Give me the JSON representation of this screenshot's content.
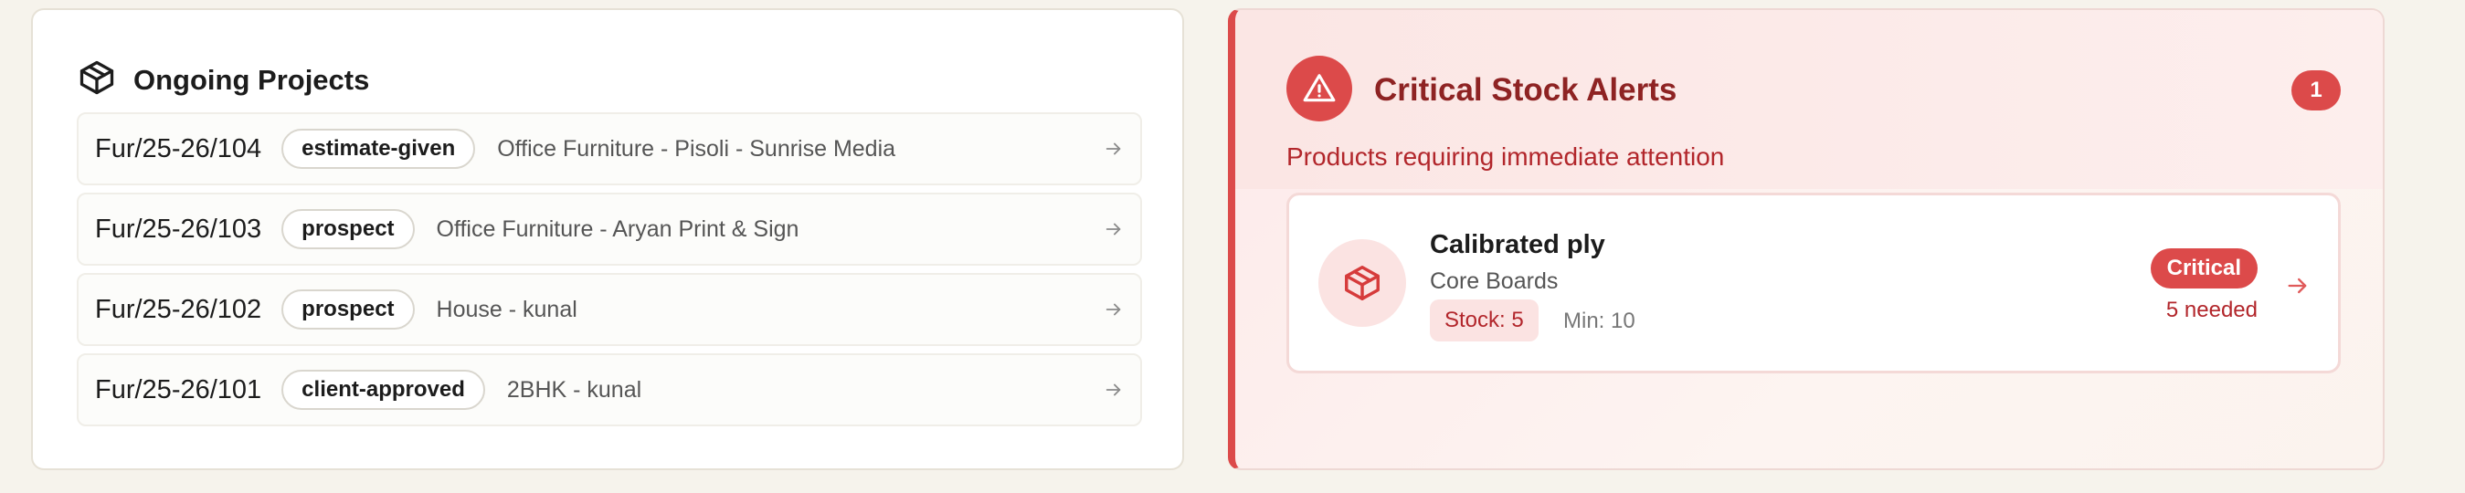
{
  "projects": {
    "title": "Ongoing Projects",
    "icon": "package-icon",
    "items": [
      {
        "code": "Fur/25-26/104",
        "status": "estimate-given",
        "description": "Office Furniture - Pisoli - Sunrise Media"
      },
      {
        "code": "Fur/25-26/103",
        "status": "prospect",
        "description": "Office Furniture - Aryan Print & Sign"
      },
      {
        "code": "Fur/25-26/102",
        "status": "prospect",
        "description": "House - kunal"
      },
      {
        "code": "Fur/25-26/101",
        "status": "client-approved",
        "description": "2BHK - kunal"
      }
    ]
  },
  "alerts": {
    "title": "Critical Stock Alerts",
    "subtitle": "Products requiring immediate attention",
    "count": "1",
    "icon": "warning-triangle-icon",
    "accent_color": "#dc4a4a",
    "items": [
      {
        "name": "Calibrated ply",
        "category": "Core Boards",
        "stock": "Stock: 5",
        "min": "Min: 10",
        "badge": "Critical",
        "needed": "5 needed"
      }
    ]
  }
}
